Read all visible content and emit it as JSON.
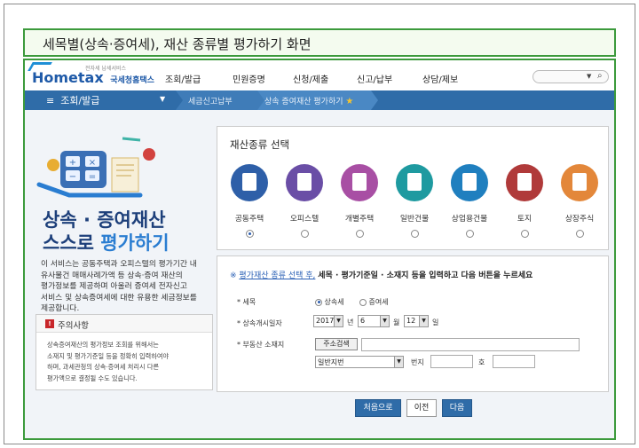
{
  "page_title": "세목별(상속·증여세), 재산 종류별 평가하기 화면",
  "header": {
    "logo_text": "Hometax",
    "logo_sub": "국세청홈택스",
    "logo_tiny": "전자세 납세서비스",
    "nav": [
      "조회/발급",
      "민원증명",
      "신청/제출",
      "신고/납부",
      "상담/제보"
    ],
    "search_dropdown_icon": "chevron-down-icon",
    "search_icon": "search-icon"
  },
  "menubar": {
    "menu_label": "조회/발급",
    "crumbs": [
      "세금신고납부",
      "상속 증여재산 평가하기"
    ],
    "star": "★"
  },
  "hero": {
    "title_line1": "상속 · 증여재산",
    "title_line2_a": "스스로",
    "title_line2_b": "평가하기",
    "description": [
      "이 서비스는 공동주택과 오피스텔의 평가기간 내",
      "유사물건 매매사례가액 등 상속·증여 재산의",
      "평가정보를 제공하며 아울러 증여세 전자신고",
      "서비스 및 상속증여세에 대한 유용한 세금정보를",
      "제공합니다."
    ]
  },
  "notice": {
    "label": "주의사항",
    "body": [
      "상속증여재산의 평가정보 조회를 위해서는",
      "소재지 및 평가기준일 등을 정확히 입력하여야",
      "하며, 과세관청의 상속·증여세 처리시 다른",
      "평가액으로 결정될 수도 있습니다."
    ]
  },
  "property_panel": {
    "title": "재산종류 선택",
    "items": [
      {
        "label": "공동주택",
        "color": "#2e5fa8",
        "selected": true
      },
      {
        "label": "오피스텔",
        "color": "#6a4ea6",
        "selected": false
      },
      {
        "label": "개별주택",
        "color": "#a84fa4",
        "selected": false
      },
      {
        "label": "일반건물",
        "color": "#1e9aa0",
        "selected": false
      },
      {
        "label": "상업용건물",
        "color": "#1f7fbf",
        "selected": false
      },
      {
        "label": "토지",
        "color": "#b03a3a",
        "selected": false
      },
      {
        "label": "상장주식",
        "color": "#e3873a",
        "selected": false
      }
    ]
  },
  "input_panel": {
    "head_a": "※",
    "head_link": "평가재산 종류 선택 후,",
    "head_b": "세목 · 평가기준일 · 소재지 등을 입력하고 다음 버튼을 누르세요",
    "tax_label": "* 세목",
    "tax_options": [
      "상속세",
      "증여세"
    ],
    "date_label": "* 상속개시일자",
    "year": "2017",
    "year_unit": "년",
    "month": "6",
    "month_unit": "월",
    "day": "12",
    "day_unit": "일",
    "address_label": "* 부동산 소재지",
    "address_button": "주소검색",
    "lot_type": "일반지번",
    "lot_unit": "번지",
    "ho_unit": "호"
  },
  "buttons": {
    "first": "처음으로",
    "prev": "이전",
    "next": "다음"
  }
}
